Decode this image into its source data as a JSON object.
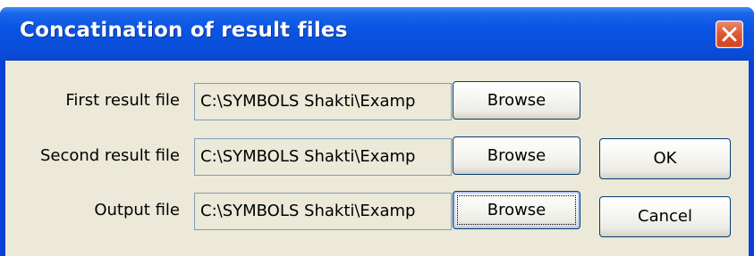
{
  "window": {
    "title": "Concatination of result files",
    "close_icon": "close-icon"
  },
  "fields": [
    {
      "label": "First result file",
      "value": "C:\\SYMBOLS Shakti\\Examp",
      "browse_label": "Browse"
    },
    {
      "label": "Second result file",
      "value": "C:\\SYMBOLS Shakti\\Examp",
      "browse_label": "Browse"
    },
    {
      "label": "Output file",
      "value": "C:\\SYMBOLS Shakti\\Examp",
      "browse_label": "Browse"
    }
  ],
  "actions": {
    "ok_label": "OK",
    "cancel_label": "Cancel"
  },
  "colors": {
    "titlebar": "#0a55e2",
    "close_button": "#de5a35",
    "dialog_face": "#ece9d8",
    "button_border": "#003c74"
  }
}
